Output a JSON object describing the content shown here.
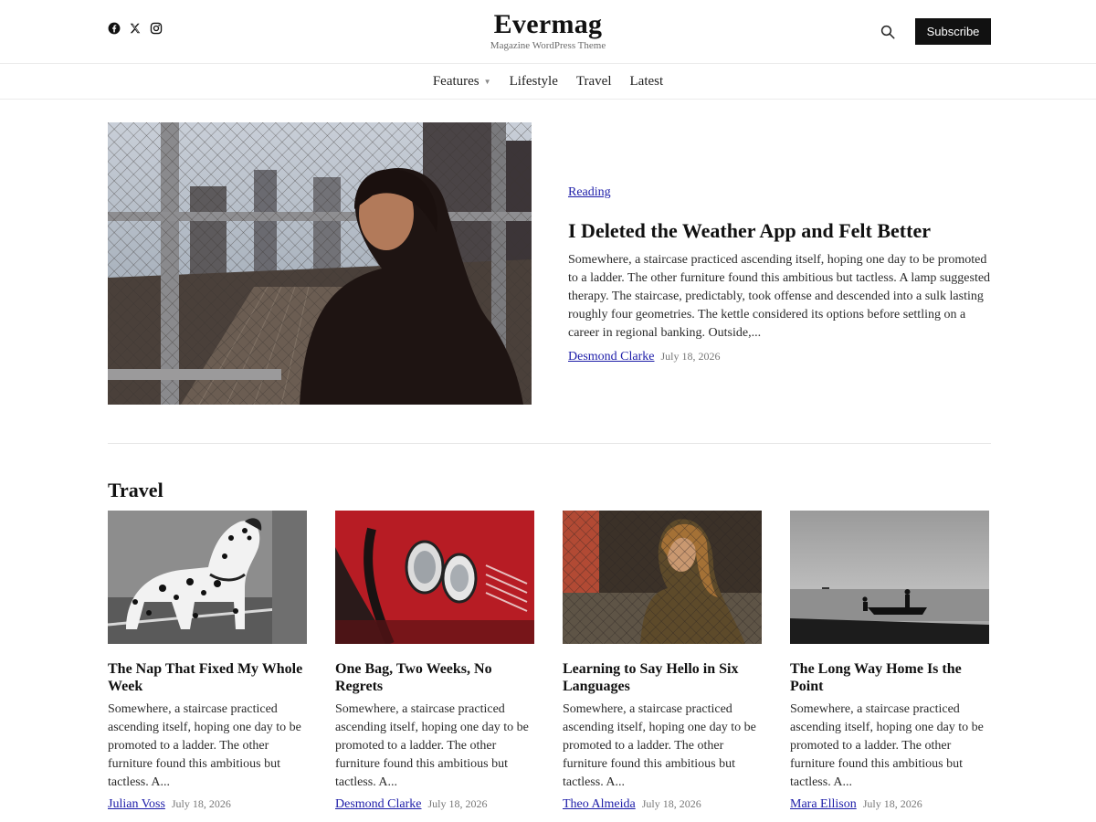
{
  "header": {
    "site_title": "Evermag",
    "tagline": "Magazine WordPress Theme",
    "social_icons": [
      "facebook-icon",
      "x-icon",
      "instagram-icon"
    ],
    "search_icon": "search-icon",
    "subscribe_label": "Subscribe"
  },
  "nav": {
    "items": [
      {
        "label": "Features",
        "has_dropdown": true
      },
      {
        "label": "Lifestyle"
      },
      {
        "label": "Travel"
      },
      {
        "label": "Latest"
      }
    ]
  },
  "hero": {
    "category": "Reading",
    "title": "I Deleted the Weather App and Felt Better",
    "excerpt": "Somewhere, a staircase practiced ascending itself, hoping one day to be promoted to a ladder. The other furniture found this ambitious but tactless. A lamp suggested therapy. The staircase, predictably, took offense and descended into a sulk lasting roughly four geometries. The kettle considered its options before settling on a career in regional banking. Outside,...",
    "author": "Desmond Clarke",
    "date": "July 18, 2026"
  },
  "travel": {
    "section_title": "Travel",
    "cards": [
      {
        "title": "The Nap That Fixed My Whole Week",
        "excerpt": "Somewhere, a staircase practiced ascending itself, hoping one day to be promoted to a ladder. The other furniture found this ambitious but tactless. A...",
        "author": "Julian Voss",
        "date": "July 18, 2026"
      },
      {
        "title": "One Bag, Two Weeks, No Regrets",
        "excerpt": "Somewhere, a staircase practiced ascending itself, hoping one day to be promoted to a ladder. The other furniture found this ambitious but tactless. A...",
        "author": "Desmond Clarke",
        "date": "July 18, 2026"
      },
      {
        "title": "Learning to Say Hello in Six Languages",
        "excerpt": "Somewhere, a staircase practiced ascending itself, hoping one day to be promoted to a ladder. The other furniture found this ambitious but tactless. A...",
        "author": "Theo Almeida",
        "date": "July 18, 2026"
      },
      {
        "title": "The Long Way Home Is the Point",
        "excerpt": "Somewhere, a staircase practiced ascending itself, hoping one day to be promoted to a ladder. The other furniture found this ambitious but tactless. A...",
        "author": "Mara Ellison",
        "date": "July 18, 2026"
      }
    ]
  },
  "colors": {
    "link": "#1c1ca8",
    "button_bg": "#111111",
    "text": "#1a1a1a",
    "muted": "#777777",
    "divider": "#e6e6e6"
  }
}
